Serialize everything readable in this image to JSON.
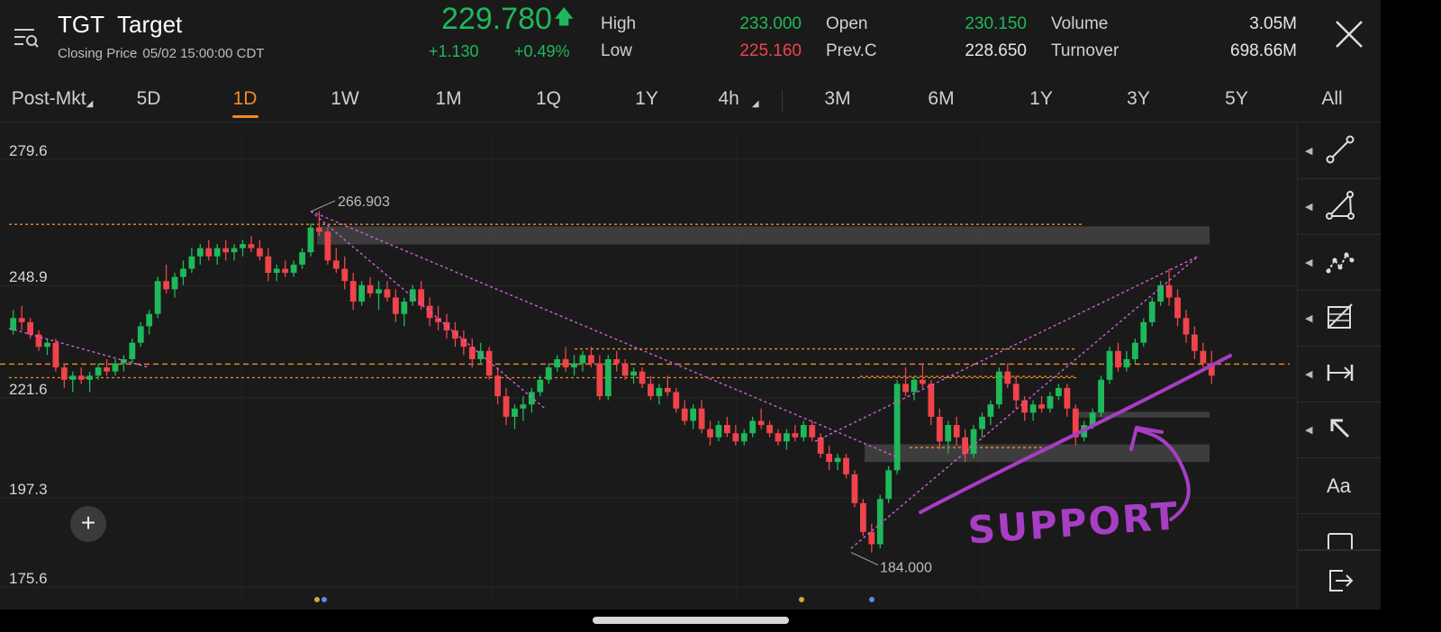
{
  "header": {
    "symbol": "TGT",
    "name": "Target",
    "closing_label": "Closing Price",
    "closing_time": "05/02 15:00:00 CDT",
    "price": "229.780",
    "change": "+1.130",
    "change_pct": "+0.49%",
    "stats": {
      "high_label": "High",
      "high": "233.000",
      "low_label": "Low",
      "low": "225.160",
      "open_label": "Open",
      "open": "230.150",
      "prevc_label": "Prev.C",
      "prevc": "228.650",
      "volume_label": "Volume",
      "volume": "3.05M",
      "turnover_label": "Turnover",
      "turnover": "698.66M"
    }
  },
  "colors": {
    "up": "#1fb85a",
    "down": "#f0434a",
    "accent": "#f08a24",
    "trendline": "#d25fd8",
    "annotation": "#a73ec4"
  },
  "tabs": [
    {
      "label": "Post-Mkt",
      "dropdown": true
    },
    {
      "label": "5D"
    },
    {
      "label": "1D",
      "active": true
    },
    {
      "label": "1W"
    },
    {
      "label": "1M"
    },
    {
      "label": "1Q"
    },
    {
      "label": "1Y"
    },
    {
      "label": "4h",
      "dropdown": true
    },
    {
      "label": "3M"
    },
    {
      "label": "6M"
    },
    {
      "label": "1Y"
    },
    {
      "label": "3Y"
    },
    {
      "label": "5Y"
    },
    {
      "label": "All"
    }
  ],
  "toolbar": {
    "tools": [
      {
        "icon": "line-tool-icon"
      },
      {
        "icon": "triangle-tool-icon"
      },
      {
        "icon": "wave-tool-icon"
      },
      {
        "icon": "fib-grid-tool-icon"
      },
      {
        "icon": "measure-tool-icon"
      },
      {
        "icon": "arrow-tool-icon"
      },
      {
        "icon": "text-tool-icon",
        "text": "Aa"
      },
      {
        "icon": "rectangle-tool-icon"
      },
      {
        "icon": "exit-icon"
      }
    ]
  },
  "chart_data": {
    "type": "candlestick",
    "y_ticks": [
      "279.6",
      "248.9",
      "221.6",
      "197.3",
      "175.6"
    ],
    "ylim": [
      175.6,
      279.6
    ],
    "y_tick_values": [
      279.6,
      248.9,
      221.6,
      197.3,
      175.6
    ],
    "annotations": {
      "high_label": "266.903",
      "low_label": "184.000",
      "handwritten": "SUPPORT"
    },
    "horizontal_levels": [
      229.8,
      226.5,
      263.8,
      233.5,
      226.8,
      209.5,
      217.0
    ],
    "resistance_zone": [
      258.9,
      263.3
    ],
    "support_zone": [
      206.0,
      210.3
    ],
    "support_band": [
      216.8,
      218.2
    ],
    "candles": [
      [
        238,
        243,
        237,
        241
      ],
      [
        241,
        244,
        238,
        240
      ],
      [
        240,
        241,
        236,
        237
      ],
      [
        237,
        238,
        233,
        234
      ],
      [
        234,
        236,
        232,
        235
      ],
      [
        235,
        236,
        228,
        229
      ],
      [
        229,
        230,
        224,
        226
      ],
      [
        226,
        228,
        223,
        227
      ],
      [
        227,
        229,
        225,
        226
      ],
      [
        226,
        228,
        223,
        227
      ],
      [
        227,
        230,
        226,
        229
      ],
      [
        229,
        231,
        227,
        228
      ],
      [
        228,
        231,
        227,
        230
      ],
      [
        230,
        232,
        228,
        231
      ],
      [
        231,
        236,
        230,
        235
      ],
      [
        235,
        240,
        234,
        239
      ],
      [
        239,
        243,
        237,
        242
      ],
      [
        242,
        251,
        241,
        250
      ],
      [
        250,
        254,
        247,
        248
      ],
      [
        248,
        252,
        246,
        251
      ],
      [
        251,
        255,
        249,
        253
      ],
      [
        253,
        258,
        252,
        256
      ],
      [
        256,
        259,
        254,
        258
      ],
      [
        258,
        260,
        255,
        256
      ],
      [
        256,
        259,
        254,
        258
      ],
      [
        258,
        260,
        255,
        257
      ],
      [
        257,
        259,
        255,
        258
      ],
      [
        258,
        260,
        256,
        259
      ],
      [
        259,
        261,
        257,
        258
      ],
      [
        258,
        260,
        255,
        256
      ],
      [
        256,
        258,
        250,
        252
      ],
      [
        252,
        254,
        250,
        253
      ],
      [
        253,
        255,
        251,
        252
      ],
      [
        252,
        255,
        251,
        254
      ],
      [
        254,
        258,
        253,
        257
      ],
      [
        257,
        264,
        256,
        263
      ],
      [
        263,
        267,
        261,
        262
      ],
      [
        262,
        263,
        254,
        255
      ],
      [
        255,
        258,
        252,
        253
      ],
      [
        253,
        256,
        248,
        250
      ],
      [
        250,
        252,
        243,
        245
      ],
      [
        245,
        250,
        244,
        249
      ],
      [
        249,
        251,
        246,
        247
      ],
      [
        247,
        250,
        243,
        248
      ],
      [
        248,
        250,
        245,
        246
      ],
      [
        246,
        248,
        240,
        242
      ],
      [
        242,
        246,
        239,
        245
      ],
      [
        245,
        249,
        244,
        248
      ],
      [
        248,
        250,
        243,
        244
      ],
      [
        244,
        246,
        239,
        241
      ],
      [
        241,
        244,
        238,
        240
      ],
      [
        240,
        242,
        236,
        238
      ],
      [
        238,
        240,
        234,
        236
      ],
      [
        236,
        238,
        232,
        234
      ],
      [
        234,
        236,
        229,
        231
      ],
      [
        231,
        235,
        230,
        233
      ],
      [
        233,
        234,
        226,
        227
      ],
      [
        227,
        229,
        220,
        222
      ],
      [
        222,
        224,
        215,
        217
      ],
      [
        217,
        220,
        214,
        219
      ],
      [
        219,
        222,
        216,
        220
      ],
      [
        220,
        224,
        218,
        223
      ],
      [
        223,
        227,
        222,
        226
      ],
      [
        226,
        230,
        225,
        229
      ],
      [
        229,
        232,
        228,
        231
      ],
      [
        231,
        234,
        228,
        229
      ],
      [
        229,
        232,
        227,
        230
      ],
      [
        230,
        233,
        228,
        232
      ],
      [
        232,
        234,
        229,
        230
      ],
      [
        230,
        232,
        221,
        222
      ],
      [
        222,
        232,
        221,
        231
      ],
      [
        231,
        233,
        228,
        230
      ],
      [
        230,
        231,
        226,
        227
      ],
      [
        227,
        229,
        225,
        228
      ],
      [
        228,
        229,
        224,
        225
      ],
      [
        225,
        227,
        221,
        222
      ],
      [
        222,
        225,
        220,
        224
      ],
      [
        224,
        227,
        222,
        223
      ],
      [
        223,
        224,
        218,
        219
      ],
      [
        219,
        221,
        215,
        216
      ],
      [
        216,
        220,
        214,
        219
      ],
      [
        219,
        221,
        213,
        214
      ],
      [
        214,
        216,
        210,
        212
      ],
      [
        212,
        216,
        211,
        215
      ],
      [
        215,
        217,
        212,
        213
      ],
      [
        213,
        215,
        210,
        211
      ],
      [
        211,
        214,
        210,
        213
      ],
      [
        213,
        217,
        212,
        216
      ],
      [
        216,
        219,
        214,
        215
      ],
      [
        215,
        216,
        212,
        213
      ],
      [
        213,
        214,
        210,
        211
      ],
      [
        211,
        214,
        209,
        213
      ],
      [
        213,
        215,
        211,
        212
      ],
      [
        212,
        216,
        211,
        215
      ],
      [
        215,
        216,
        211,
        212
      ],
      [
        212,
        213,
        207,
        208
      ],
      [
        208,
        210,
        204,
        206
      ],
      [
        206,
        208,
        204,
        207
      ],
      [
        207,
        208,
        202,
        203
      ],
      [
        203,
        204,
        195,
        196
      ],
      [
        196,
        197,
        188,
        189
      ],
      [
        189,
        191,
        184,
        186
      ],
      [
        186,
        198,
        185,
        197
      ],
      [
        197,
        205,
        196,
        204
      ],
      [
        204,
        226,
        203,
        225
      ],
      [
        225,
        229,
        222,
        223
      ],
      [
        223,
        227,
        221,
        226
      ],
      [
        226,
        230,
        224,
        225
      ],
      [
        225,
        226,
        215,
        217
      ],
      [
        217,
        219,
        209,
        211
      ],
      [
        211,
        216,
        208,
        215
      ],
      [
        215,
        217,
        210,
        212
      ],
      [
        212,
        214,
        206,
        208
      ],
      [
        208,
        215,
        207,
        214
      ],
      [
        214,
        218,
        212,
        217
      ],
      [
        217,
        221,
        215,
        220
      ],
      [
        220,
        229,
        219,
        228
      ],
      [
        228,
        230,
        224,
        225
      ],
      [
        225,
        227,
        219,
        221
      ],
      [
        221,
        222,
        216,
        218
      ],
      [
        218,
        221,
        216,
        220
      ],
      [
        220,
        222,
        218,
        219
      ],
      [
        219,
        223,
        218,
        222
      ],
      [
        222,
        225,
        221,
        224
      ],
      [
        224,
        225,
        217,
        219
      ],
      [
        219,
        220,
        210,
        212
      ],
      [
        212,
        216,
        211,
        215
      ],
      [
        215,
        219,
        214,
        218
      ],
      [
        218,
        227,
        217,
        226
      ],
      [
        226,
        234,
        225,
        233
      ],
      [
        233,
        235,
        228,
        229
      ],
      [
        229,
        233,
        228,
        231
      ],
      [
        231,
        236,
        230,
        235
      ],
      [
        235,
        241,
        234,
        240
      ],
      [
        240,
        246,
        239,
        245
      ],
      [
        245,
        250,
        244,
        249
      ],
      [
        249,
        253,
        244,
        246
      ],
      [
        246,
        248,
        239,
        241
      ],
      [
        241,
        243,
        235,
        237
      ],
      [
        237,
        239,
        231,
        233
      ],
      [
        233,
        235,
        229,
        230
      ],
      [
        230,
        233,
        225,
        227
      ]
    ]
  }
}
